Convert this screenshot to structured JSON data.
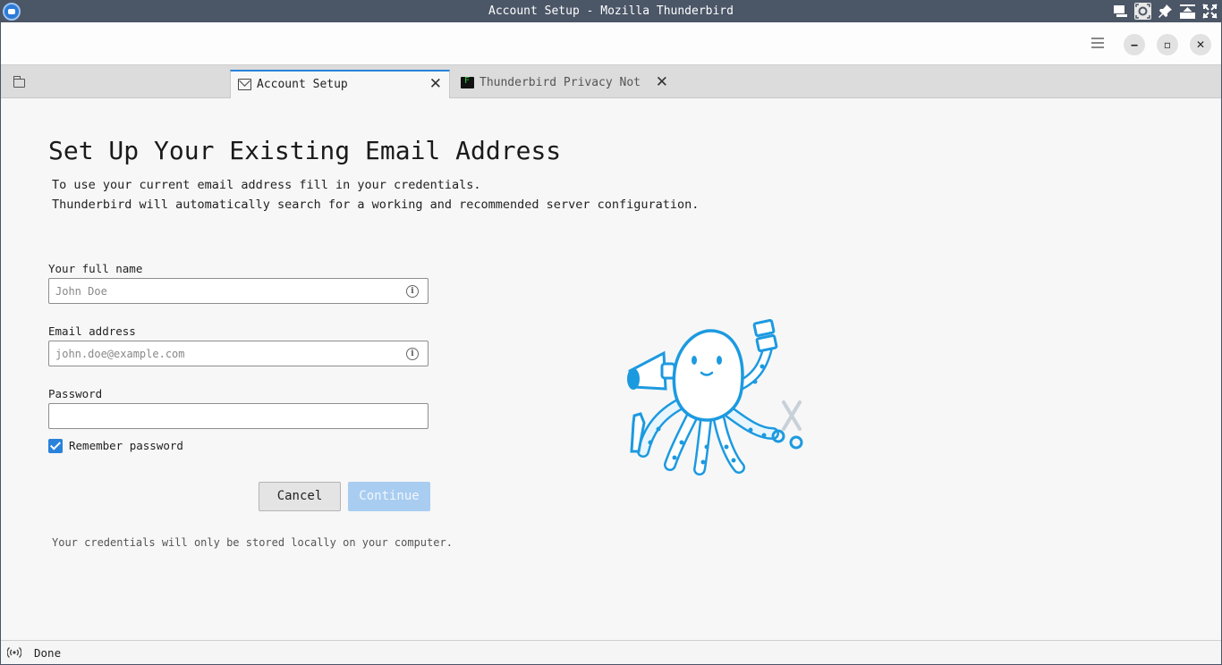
{
  "os_titlebar": {
    "title": "Account Setup - Mozilla Thunderbird",
    "icons": [
      "thunderbird-app-icon",
      "window-list-icon",
      "screenshot-icon",
      "pin-icon",
      "maximize-icon",
      "fullscreen-icon"
    ]
  },
  "toolbar": {
    "menu_icon": "hamburger-menu-icon",
    "minimize": "‒",
    "maximize": "▫",
    "close": "✕"
  },
  "tabs": [
    {
      "label": "",
      "icon": "folder-icon"
    },
    {
      "label": "Account Setup",
      "icon": "mail-setup-icon",
      "close": "✕",
      "active": true
    },
    {
      "label": "Thunderbird Privacy Notice —",
      "icon": "terminal-icon",
      "close": "✕",
      "active": false
    }
  ],
  "main": {
    "heading": "Set Up Your Existing Email Address",
    "description_line1": "To use your current email address fill in your credentials.",
    "description_line2": "Thunderbird will automatically search for a working and recommended server configuration.",
    "full_name": {
      "label": "Your full name",
      "placeholder": "John Doe",
      "value": ""
    },
    "email": {
      "label": "Email address",
      "placeholder": "john.doe@example.com",
      "value": ""
    },
    "password": {
      "label": "Password",
      "value": ""
    },
    "remember": {
      "label": "Remember password",
      "checked": true
    },
    "cancel_label": "Cancel",
    "continue_label": "Continue",
    "note": "Your credentials will only be stored locally on your computer."
  },
  "status": {
    "text": "Done",
    "icon": "online-status-icon"
  },
  "colors": {
    "accent": "#2a82da",
    "continue_disabled": "#a9cdf1",
    "titlebar": "#4b5667"
  }
}
